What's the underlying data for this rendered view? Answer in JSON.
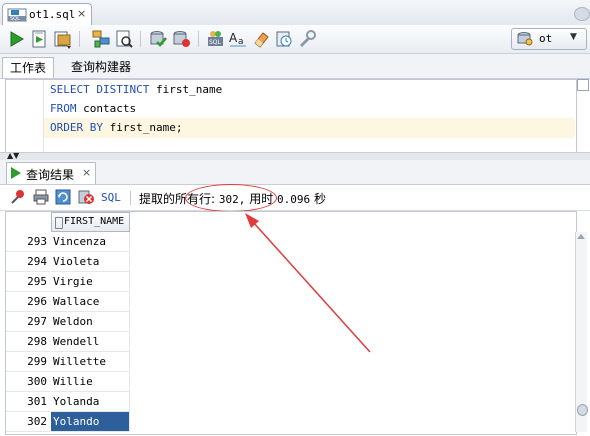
{
  "tab": {
    "filename": "ot1.sql",
    "close": "×"
  },
  "connection": {
    "name": "ot"
  },
  "subtabs": {
    "worksheet": "工作表",
    "query_builder": "查询构建器"
  },
  "editor": {
    "lines": [
      {
        "kw": "SELECT DISTINCT",
        "rest": " first_name"
      },
      {
        "kw": "FROM",
        "rest": " contacts"
      },
      {
        "kw": "ORDER BY",
        "rest": " first_name;"
      }
    ]
  },
  "results": {
    "tab_label": "查询结果",
    "tab_close": "×",
    "sql_button": "SQL",
    "status_prefix": "提取的所有行:",
    "status_count": "302,",
    "status_time_label": "用时",
    "status_time": "0.096",
    "status_unit": "秒",
    "column_header": "FIRST_NAME",
    "rows": [
      {
        "num": "293",
        "name": "Vincenza"
      },
      {
        "num": "294",
        "name": "Violeta"
      },
      {
        "num": "295",
        "name": "Virgie"
      },
      {
        "num": "296",
        "name": "Wallace"
      },
      {
        "num": "297",
        "name": "Weldon"
      },
      {
        "num": "298",
        "name": "Wendell"
      },
      {
        "num": "299",
        "name": "Willette"
      },
      {
        "num": "300",
        "name": "Willie"
      },
      {
        "num": "301",
        "name": "Yolanda"
      },
      {
        "num": "302",
        "name": "Yolando"
      }
    ],
    "selected_row": "302"
  },
  "annotation": {
    "color": "#e23b3b"
  },
  "colors": {
    "keyword": "#1f4fb5",
    "selection": "#2d5f9a",
    "run_green": "#2d9b2d"
  }
}
